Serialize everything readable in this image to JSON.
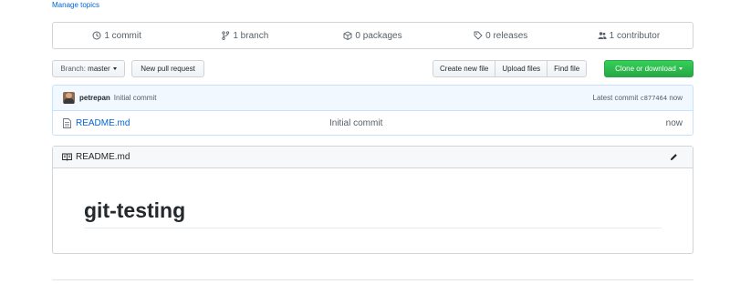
{
  "topics": {
    "manage_label": "Manage topics"
  },
  "summary": {
    "commits": "1 commit",
    "branches": "1 branch",
    "packages": "0 packages",
    "releases": "0 releases",
    "contributors": "1 contributor"
  },
  "file_nav": {
    "branch_prefix": "Branch:",
    "branch_name": "master",
    "new_pull_request": "New pull request",
    "create_new_file": "Create new file",
    "upload_files": "Upload files",
    "find_file": "Find file",
    "clone_or_download": "Clone or download"
  },
  "latest_commit": {
    "author": "petrepan",
    "message": "Initial commit",
    "prefix": "Latest commit",
    "sha": "c877464",
    "age": "now"
  },
  "files": [
    {
      "name": "README.md",
      "commit_message": "Initial commit",
      "age": "now"
    }
  ],
  "readme": {
    "filename": "README.md",
    "title": "git-testing"
  },
  "colors": {
    "link": "#0366d6",
    "green_button": "#28a745",
    "commit_bg": "#f1f8ff"
  }
}
